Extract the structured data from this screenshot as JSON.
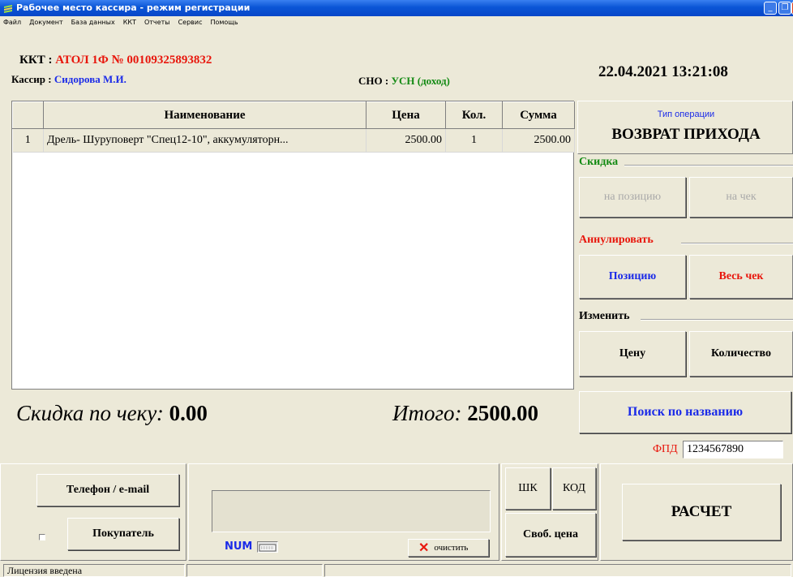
{
  "window": {
    "title": "Рабочее место кассира - режим регистрации"
  },
  "menu": [
    "Файл",
    "Документ",
    "База данных",
    "ККТ",
    "Отчеты",
    "Сервис",
    "Помощь"
  ],
  "header": {
    "kkt_label": "ККТ :",
    "kkt_value": "АТОЛ 1Ф № 00109325893832",
    "cashier_label": "Кассир :",
    "cashier_value": "Сидорова М.И.",
    "sno_label": "СНО :",
    "sno_value": "УСН (доход)",
    "datetime": "22.04.2021  13:21:08"
  },
  "table": {
    "columns": [
      "",
      "Наименование",
      "Цена",
      "Кол.",
      "Сумма"
    ],
    "rows": [
      {
        "n": "1",
        "name": "Дрель- Шуруповерт \"Спец12-10\", аккумуляторн...",
        "price": "2500.00",
        "qty": "1",
        "sum": "2500.00"
      }
    ]
  },
  "operation": {
    "label": "Тип операции",
    "value": "ВОЗВРАТ ПРИХОДА"
  },
  "discount": {
    "title": "Скидка",
    "on_item": "на позицию",
    "on_check": "на чек"
  },
  "annul": {
    "title": "Аннулировать",
    "item": "Позицию",
    "whole": "Весь чек"
  },
  "change": {
    "title": "Изменить",
    "price": "Цену",
    "qty": "Количество"
  },
  "search_button": "Поиск по названию",
  "totals": {
    "discount_label": "Скидка по чеку:",
    "discount_value": "0.00",
    "total_label": "Итого:",
    "total_value": "2500.00"
  },
  "fpd": {
    "label": "ФПД",
    "value": "1234567890"
  },
  "bottom": {
    "phone_email": "Телефон / e-mail",
    "buyer": "Покупатель",
    "num": "NUM",
    "clear": "очистить",
    "shk": "ШК",
    "kod": "КОД",
    "free_price": "Своб. цена",
    "pay": "РАСЧЕТ"
  },
  "status": {
    "left": "Лицензия введена"
  },
  "colors": {
    "red": "#e8160c",
    "blue": "#1b2be8",
    "green": "#138a13"
  }
}
